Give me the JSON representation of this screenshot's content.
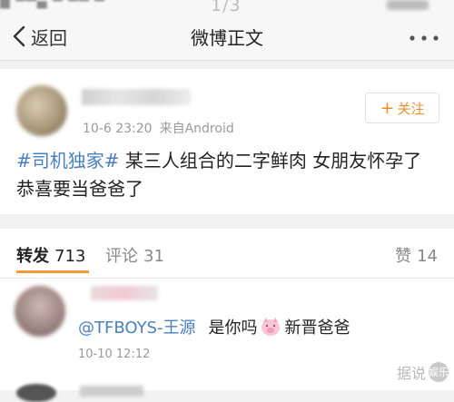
{
  "statusbar": {
    "page_indicator": "1/3"
  },
  "navbar": {
    "back_label": "返回",
    "title": "微博正文"
  },
  "post": {
    "meta_time": "10-6 23:20",
    "meta_source": "来自Android",
    "follow_label": "关注",
    "topic": "#司机独家#",
    "text": " 某三人组合的二字鲜肉 女朋友怀孕了 恭喜要当爸爸了"
  },
  "stats": {
    "repost_label": "转发",
    "repost_count": "713",
    "comment_label": "评论",
    "comment_count": "31",
    "like_label": "赞",
    "like_count": "14"
  },
  "comment": {
    "mention": "@TFBOYS-王源",
    "text_before": "是你吗",
    "text_after": "新晋爸爸",
    "time": "10-10 12:12"
  },
  "watermark": {
    "text": "据说",
    "badge": "娱乐"
  },
  "colors": {
    "accent_orange": "#f08c2e",
    "link_blue": "#4a7fbf"
  }
}
